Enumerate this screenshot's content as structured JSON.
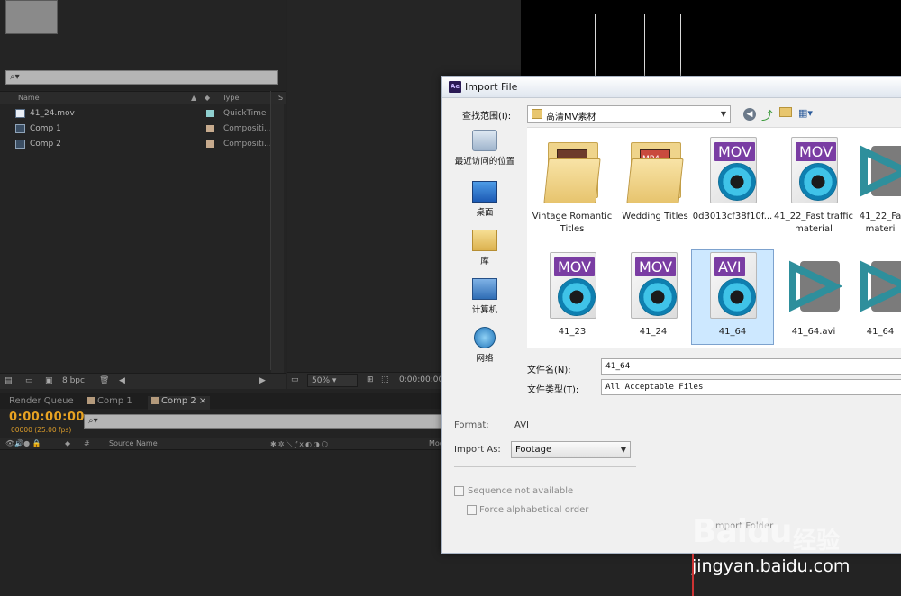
{
  "project_panel": {
    "columns": {
      "name": "Name",
      "type": "Type",
      "extra": "S"
    },
    "items": [
      {
        "name": "41_24.mov",
        "type": "QuickTime",
        "swatch": "#8fcfcf"
      },
      {
        "name": "Comp 1",
        "type": "Compositi...",
        "swatch": "#c7ab8e"
      },
      {
        "name": "Comp 2",
        "type": "Compositi...",
        "swatch": "#c7ab8e"
      }
    ],
    "bpc": "8 bpc"
  },
  "viewer": {
    "zoom": "50%",
    "timecode": "0:00:00:00"
  },
  "timeline": {
    "tabs": [
      "Render Queue",
      "Comp 1",
      "Comp 2"
    ],
    "current_time": "0:00:00:00",
    "fps": "00000 (25.00 fps)",
    "header": {
      "index": "#",
      "source": "Source Name",
      "mode": "Mod"
    }
  },
  "dialog": {
    "title": "Import File",
    "logo": "Ae",
    "look_in_label": "查找范围(I):",
    "look_in_value": "高清MV素材",
    "places": [
      "最近访问的位置",
      "桌面",
      "库",
      "计算机",
      "网络"
    ],
    "files": [
      {
        "name": "Vintage Romantic Titles",
        "kind": "folder"
      },
      {
        "name": "Wedding Titles",
        "kind": "folder"
      },
      {
        "name": "0d3013cf38f10f...",
        "kind": "mov"
      },
      {
        "name": "41_22_Fast traffic material",
        "kind": "mov"
      },
      {
        "name": "41_22_Fa materi",
        "kind": "play"
      },
      {
        "name": "41_23",
        "kind": "mov"
      },
      {
        "name": "41_24",
        "kind": "mov"
      },
      {
        "name": "41_64",
        "kind": "avi"
      },
      {
        "name": "41_64.avi",
        "kind": "play"
      },
      {
        "name": "41_64",
        "kind": "play"
      }
    ],
    "badges": {
      "mov": "MOV",
      "avi": "AVI",
      "mp4": "MP4"
    },
    "filename_label": "文件名(N):",
    "filename_value": "41_64",
    "filetype_label": "文件类型(T):",
    "filetype_value": "All Acceptable Files",
    "format_label": "Format:",
    "format_value": "AVI",
    "import_as_label": "Import As:",
    "import_as_value": "Footage",
    "sequence_label": "Sequence not available",
    "force_alpha_label": "Force alphabetical order",
    "import_folder_label": "Import Folder"
  },
  "watermark": {
    "url": "jingyan.baidu.com",
    "logo": "Baidu",
    "cn": "经验"
  }
}
